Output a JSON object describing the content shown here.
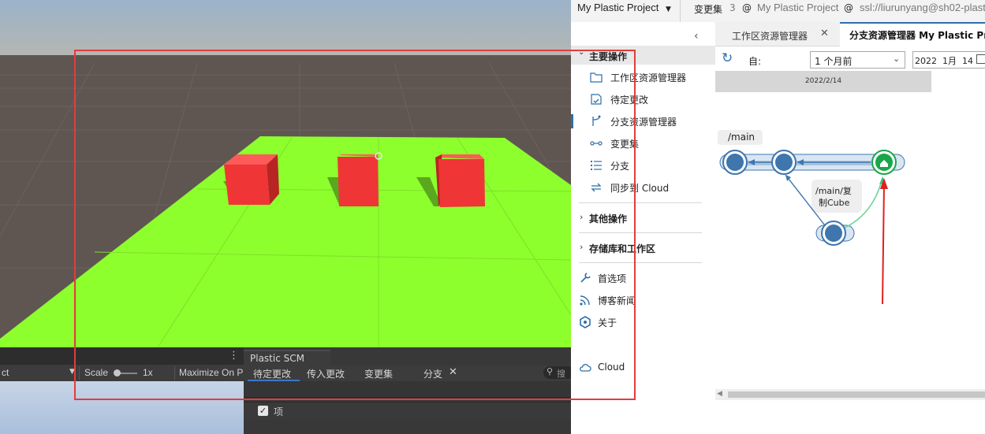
{
  "unity": {
    "toolbar": {
      "left_label": "ct",
      "scale_label": "Scale",
      "scale_value": "1x",
      "maximize_label": "Maximize On P"
    },
    "plastic_panel": {
      "title": "Plastic SCM",
      "tabs": [
        "待定更改",
        "传入更改",
        "变更集",
        "分支"
      ],
      "search_placeholder": "搜",
      "items_header": "项"
    }
  },
  "desktop": {
    "title_bar": {
      "project": "My Plastic Project",
      "changeset_label": "变更集",
      "changeset_number": "3",
      "at1": "@",
      "repo": "My Plastic Project",
      "at2": "@",
      "server": "ssl://liurunyang@sh02-plast"
    },
    "sidebar": {
      "main_ops": "主要操作",
      "items": [
        {
          "label": "工作区资源管理器",
          "icon": "folder-icon"
        },
        {
          "label": "待定更改",
          "icon": "pending-changes-icon"
        },
        {
          "label": "分支资源管理器",
          "icon": "branch-explorer-icon"
        },
        {
          "label": "变更集",
          "icon": "changeset-icon"
        },
        {
          "label": "分支",
          "icon": "branches-icon"
        },
        {
          "label": "同步到 Cloud",
          "icon": "sync-icon"
        }
      ],
      "other_ops": "其他操作",
      "repos_ws": "存储库和工作区",
      "bottom_items": [
        {
          "label": "首选项",
          "icon": "wrench-icon"
        },
        {
          "label": "博客新闻",
          "icon": "rss-icon"
        },
        {
          "label": "关于",
          "icon": "plastic-logo-icon"
        }
      ],
      "cloud": "Cloud"
    },
    "tabs": {
      "workspace": "工作区资源管理器",
      "branch": "分支资源管理器 My Plastic Pr"
    },
    "filter": {
      "from_label": "自:",
      "range": "1 个月前",
      "date": "2022  1月  14"
    },
    "graph": {
      "date_header": "2022/2/14",
      "main_branch": "/main",
      "child_branch_line1": "/main/复",
      "child_branch_line2": "制Cube"
    },
    "colors": {
      "accent": "#2f6fab",
      "node": "#3e76ad",
      "head": "#1aa64a",
      "arrow": "#e02020",
      "highlight_box": "#e23c3c"
    }
  }
}
